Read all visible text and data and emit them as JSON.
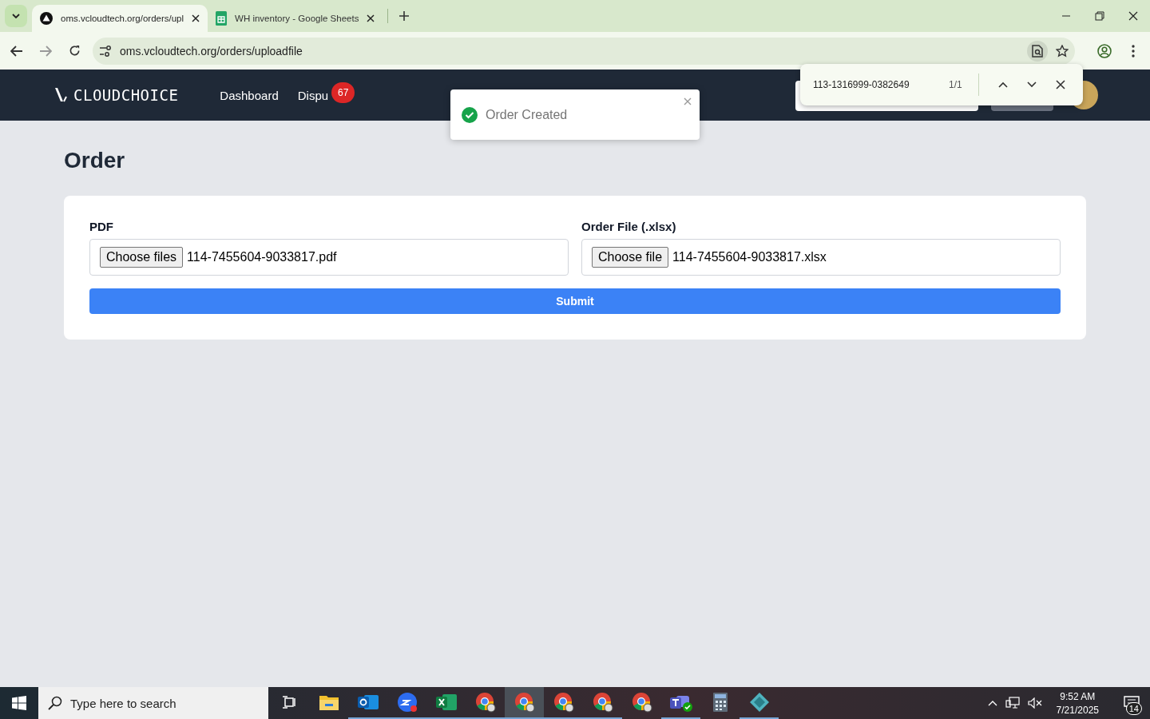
{
  "browser": {
    "tabs": [
      {
        "title": "oms.vcloudtech.org/orders/upl",
        "selected": true,
        "kind": "site"
      },
      {
        "title": "WH inventory - Google Sheets",
        "selected": false,
        "kind": "sheets"
      }
    ],
    "address": "oms.vcloudtech.org/orders/uploadfile"
  },
  "header": {
    "logo": "CLOUDCHOICE",
    "nav": [
      {
        "label": "Dashboard"
      },
      {
        "label": "Dispu",
        "badge": "67"
      }
    ]
  },
  "toast": {
    "message": "Order Created"
  },
  "find_bar": {
    "query": "113-1316999-0382649",
    "count": "1/1"
  },
  "page": {
    "title": "Order",
    "fields": [
      {
        "label": "PDF",
        "button": "Choose files",
        "value": "114-7455604-9033817.pdf"
      },
      {
        "label": "Order File (.xlsx)",
        "button": "Choose file",
        "value": "114-7455604-9033817.xlsx"
      }
    ],
    "submit": "Submit"
  },
  "taskbar": {
    "search_placeholder": "Type here to search",
    "apps": [
      {
        "kind": "taskview",
        "running": false,
        "selected": false
      },
      {
        "kind": "folder",
        "running": false,
        "selected": false
      },
      {
        "kind": "outlook",
        "running": true,
        "selected": false
      },
      {
        "kind": "zoom",
        "running": true,
        "selected": false
      },
      {
        "kind": "excel",
        "running": true,
        "selected": false
      },
      {
        "kind": "chrome",
        "running": true,
        "selected": false
      },
      {
        "kind": "chrome",
        "running": true,
        "selected": true
      },
      {
        "kind": "chrome",
        "running": true,
        "selected": false
      },
      {
        "kind": "chrome",
        "running": true,
        "selected": false
      },
      {
        "kind": "chrome",
        "running": false,
        "selected": false
      },
      {
        "kind": "teams",
        "running": true,
        "selected": false
      },
      {
        "kind": "calculator",
        "running": false,
        "selected": false
      },
      {
        "kind": "diamond",
        "running": true,
        "selected": false
      }
    ],
    "time": "9:52 AM",
    "date": "7/21/2025",
    "notifications": "14"
  }
}
